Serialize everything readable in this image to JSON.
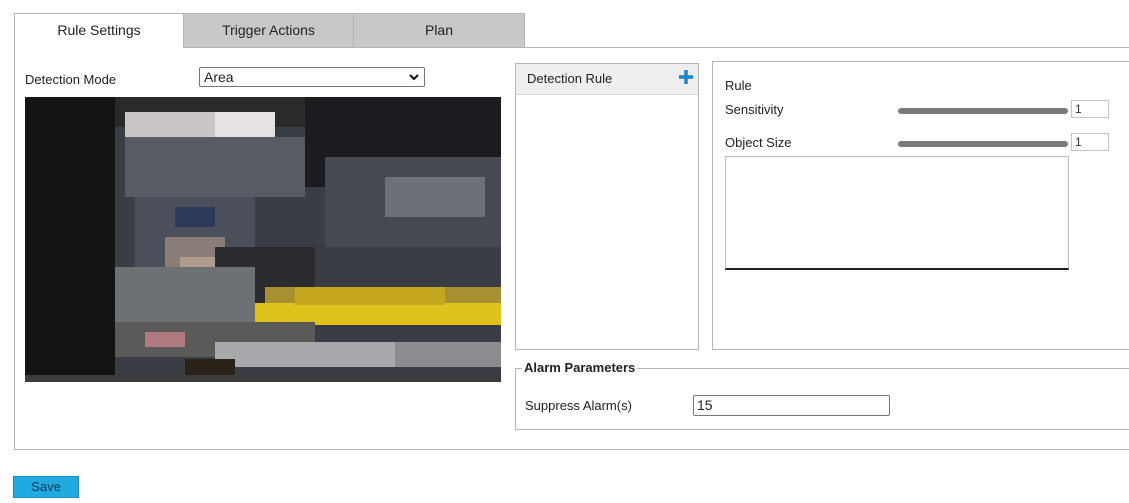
{
  "tabs": [
    {
      "label": "Rule Settings",
      "active": true
    },
    {
      "label": "Trigger Actions",
      "active": false
    },
    {
      "label": "Plan",
      "active": false
    }
  ],
  "detection_mode": {
    "label": "Detection Mode",
    "value": "Area"
  },
  "detection_rule_list": {
    "header": "Detection Rule",
    "add_icon": "plus-icon"
  },
  "rule": {
    "title": "Rule",
    "sensitivity": {
      "label": "Sensitivity",
      "value": "1"
    },
    "object_size": {
      "label": "Object Size",
      "value": "1"
    }
  },
  "alarm_parameters": {
    "legend": "Alarm Parameters",
    "suppress_label": "Suppress Alarm(s)",
    "suppress_value": "15"
  },
  "save_label": "Save",
  "colors": {
    "accent": "#21a9e2",
    "plus": "#1e88c8"
  }
}
